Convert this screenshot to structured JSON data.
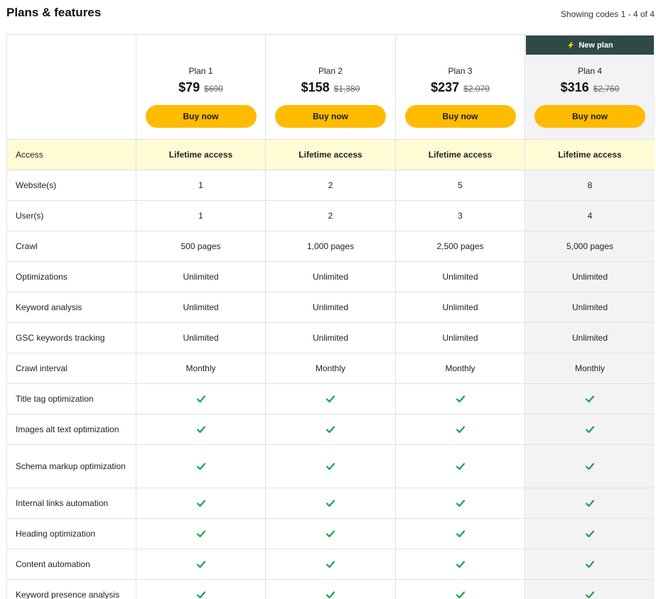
{
  "header": {
    "title": "Plans & features",
    "showing": "Showing codes 1 - 4 of 4"
  },
  "plans": [
    {
      "name": "Plan 1",
      "price": "$79",
      "old_price": "$690",
      "buy_label": "Buy now",
      "badge": ""
    },
    {
      "name": "Plan 2",
      "price": "$158",
      "old_price": "$1,380",
      "buy_label": "Buy now",
      "badge": ""
    },
    {
      "name": "Plan 3",
      "price": "$237",
      "old_price": "$2,070",
      "buy_label": "Buy now",
      "badge": ""
    },
    {
      "name": "Plan 4",
      "price": "$316",
      "old_price": "$2,760",
      "buy_label": "Buy now",
      "badge": "New plan"
    }
  ],
  "features": [
    {
      "label": "Access",
      "values": [
        "Lifetime access",
        "Lifetime access",
        "Lifetime access",
        "Lifetime access"
      ]
    },
    {
      "label": "Website(s)",
      "values": [
        "1",
        "2",
        "5",
        "8"
      ]
    },
    {
      "label": "User(s)",
      "values": [
        "1",
        "2",
        "3",
        "4"
      ]
    },
    {
      "label": "Crawl",
      "values": [
        "500 pages",
        "1,000 pages",
        "2,500 pages",
        "5,000 pages"
      ]
    },
    {
      "label": "Optimizations",
      "values": [
        "Unlimited",
        "Unlimited",
        "Unlimited",
        "Unlimited"
      ]
    },
    {
      "label": "Keyword analysis",
      "values": [
        "Unlimited",
        "Unlimited",
        "Unlimited",
        "Unlimited"
      ]
    },
    {
      "label": "GSC keywords tracking",
      "values": [
        "Unlimited",
        "Unlimited",
        "Unlimited",
        "Unlimited"
      ]
    },
    {
      "label": "Crawl interval",
      "values": [
        "Monthly",
        "Monthly",
        "Monthly",
        "Monthly"
      ]
    },
    {
      "label": "Title tag optimization",
      "check": true
    },
    {
      "label": "Images alt text optimization",
      "check": true
    },
    {
      "label": "Schema markup optimization",
      "check": true
    },
    {
      "label": "Internal links automation",
      "check": true
    },
    {
      "label": "Heading optimization",
      "check": true
    },
    {
      "label": "Content automation",
      "check": true
    },
    {
      "label": "Keyword presence analysis",
      "check": true
    }
  ],
  "colors": {
    "accent_button": "#ffbb00",
    "access_row": "#fffbd4",
    "highlight_column": "#f3f3f6",
    "banner": "#2e4a47",
    "check": "#1aa34a"
  },
  "icons": {
    "check": "check-icon",
    "banner": "lightning-icon"
  }
}
